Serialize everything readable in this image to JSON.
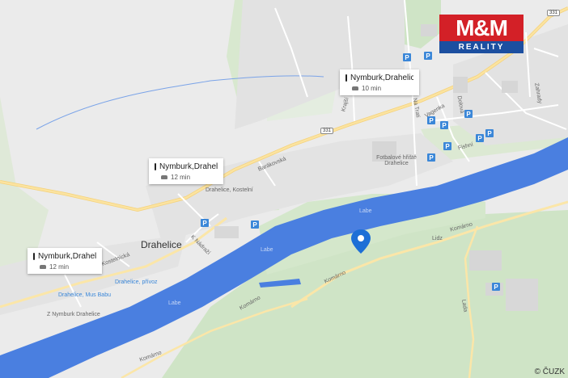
{
  "logo": {
    "top": "M&M",
    "bottom": "REALITY"
  },
  "town": "Drahelice",
  "copyright": "© ČUZK",
  "transit_cards": [
    {
      "title": "Nymburk,Drahelic...",
      "time": "10 min"
    },
    {
      "title": "Nymburk,Drahelic...",
      "time": "12 min"
    },
    {
      "title": "Nymburk,Drahelic...",
      "time": "12 min"
    }
  ],
  "road_numbers": [
    "331",
    "331",
    "331"
  ],
  "street_labels": {
    "barakovska": "Barákovská",
    "kostelnicka": "Kostelnícká",
    "k_nadrazi": "K Nádraží",
    "komarno1": "Komárno",
    "komarno2": "Komárno",
    "komarno3": "Komárno",
    "komarno4": "Komárno",
    "ludz": "Lidz",
    "lada": "Lada",
    "labe1": "Labe",
    "labe2": "Labe",
    "labe3": "Labe",
    "vagenka": "Vagenka",
    "dolova": "Dolová",
    "fishni": "Fishní",
    "na_trati": "Na Trati",
    "kralice": "Krajší",
    "fotbal": "Fotbalové hřiště Drahelice",
    "zahrady": "Zahrady",
    "stop1": "Drahelice, Mus Babu",
    "stop2": "Drahelice, přívoz",
    "stop3": "Z Nymburk Drahelice",
    "stop4": "Drahelice, Kostelní"
  },
  "colors": {
    "river": "#4a7fe0",
    "road": "#f7d98a",
    "green": "#cfe4c6",
    "bg": "#ebebeb"
  },
  "icons": [
    "parking-icon",
    "bus-icon",
    "car-icon",
    "map-pin-icon"
  ]
}
